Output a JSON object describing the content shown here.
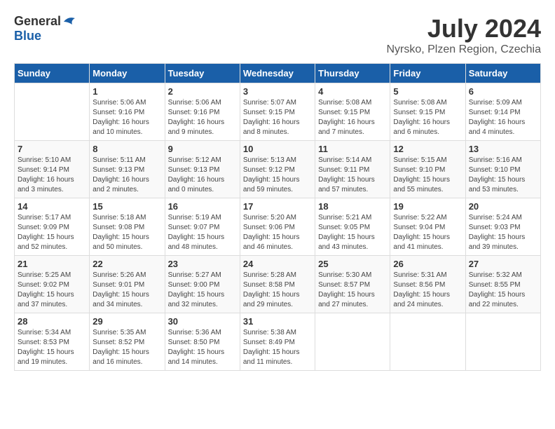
{
  "logo": {
    "general": "General",
    "blue": "Blue"
  },
  "title": "July 2024",
  "location": "Nyrsko, Plzen Region, Czechia",
  "weekdays": [
    "Sunday",
    "Monday",
    "Tuesday",
    "Wednesday",
    "Thursday",
    "Friday",
    "Saturday"
  ],
  "weeks": [
    [
      {
        "day": "",
        "sunrise": "",
        "sunset": "",
        "daylight": ""
      },
      {
        "day": "1",
        "sunrise": "Sunrise: 5:06 AM",
        "sunset": "Sunset: 9:16 PM",
        "daylight": "Daylight: 16 hours and 10 minutes."
      },
      {
        "day": "2",
        "sunrise": "Sunrise: 5:06 AM",
        "sunset": "Sunset: 9:16 PM",
        "daylight": "Daylight: 16 hours and 9 minutes."
      },
      {
        "day": "3",
        "sunrise": "Sunrise: 5:07 AM",
        "sunset": "Sunset: 9:15 PM",
        "daylight": "Daylight: 16 hours and 8 minutes."
      },
      {
        "day": "4",
        "sunrise": "Sunrise: 5:08 AM",
        "sunset": "Sunset: 9:15 PM",
        "daylight": "Daylight: 16 hours and 7 minutes."
      },
      {
        "day": "5",
        "sunrise": "Sunrise: 5:08 AM",
        "sunset": "Sunset: 9:15 PM",
        "daylight": "Daylight: 16 hours and 6 minutes."
      },
      {
        "day": "6",
        "sunrise": "Sunrise: 5:09 AM",
        "sunset": "Sunset: 9:14 PM",
        "daylight": "Daylight: 16 hours and 4 minutes."
      }
    ],
    [
      {
        "day": "7",
        "sunrise": "Sunrise: 5:10 AM",
        "sunset": "Sunset: 9:14 PM",
        "daylight": "Daylight: 16 hours and 3 minutes."
      },
      {
        "day": "8",
        "sunrise": "Sunrise: 5:11 AM",
        "sunset": "Sunset: 9:13 PM",
        "daylight": "Daylight: 16 hours and 2 minutes."
      },
      {
        "day": "9",
        "sunrise": "Sunrise: 5:12 AM",
        "sunset": "Sunset: 9:13 PM",
        "daylight": "Daylight: 16 hours and 0 minutes."
      },
      {
        "day": "10",
        "sunrise": "Sunrise: 5:13 AM",
        "sunset": "Sunset: 9:12 PM",
        "daylight": "Daylight: 15 hours and 59 minutes."
      },
      {
        "day": "11",
        "sunrise": "Sunrise: 5:14 AM",
        "sunset": "Sunset: 9:11 PM",
        "daylight": "Daylight: 15 hours and 57 minutes."
      },
      {
        "day": "12",
        "sunrise": "Sunrise: 5:15 AM",
        "sunset": "Sunset: 9:10 PM",
        "daylight": "Daylight: 15 hours and 55 minutes."
      },
      {
        "day": "13",
        "sunrise": "Sunrise: 5:16 AM",
        "sunset": "Sunset: 9:10 PM",
        "daylight": "Daylight: 15 hours and 53 minutes."
      }
    ],
    [
      {
        "day": "14",
        "sunrise": "Sunrise: 5:17 AM",
        "sunset": "Sunset: 9:09 PM",
        "daylight": "Daylight: 15 hours and 52 minutes."
      },
      {
        "day": "15",
        "sunrise": "Sunrise: 5:18 AM",
        "sunset": "Sunset: 9:08 PM",
        "daylight": "Daylight: 15 hours and 50 minutes."
      },
      {
        "day": "16",
        "sunrise": "Sunrise: 5:19 AM",
        "sunset": "Sunset: 9:07 PM",
        "daylight": "Daylight: 15 hours and 48 minutes."
      },
      {
        "day": "17",
        "sunrise": "Sunrise: 5:20 AM",
        "sunset": "Sunset: 9:06 PM",
        "daylight": "Daylight: 15 hours and 46 minutes."
      },
      {
        "day": "18",
        "sunrise": "Sunrise: 5:21 AM",
        "sunset": "Sunset: 9:05 PM",
        "daylight": "Daylight: 15 hours and 43 minutes."
      },
      {
        "day": "19",
        "sunrise": "Sunrise: 5:22 AM",
        "sunset": "Sunset: 9:04 PM",
        "daylight": "Daylight: 15 hours and 41 minutes."
      },
      {
        "day": "20",
        "sunrise": "Sunrise: 5:24 AM",
        "sunset": "Sunset: 9:03 PM",
        "daylight": "Daylight: 15 hours and 39 minutes."
      }
    ],
    [
      {
        "day": "21",
        "sunrise": "Sunrise: 5:25 AM",
        "sunset": "Sunset: 9:02 PM",
        "daylight": "Daylight: 15 hours and 37 minutes."
      },
      {
        "day": "22",
        "sunrise": "Sunrise: 5:26 AM",
        "sunset": "Sunset: 9:01 PM",
        "daylight": "Daylight: 15 hours and 34 minutes."
      },
      {
        "day": "23",
        "sunrise": "Sunrise: 5:27 AM",
        "sunset": "Sunset: 9:00 PM",
        "daylight": "Daylight: 15 hours and 32 minutes."
      },
      {
        "day": "24",
        "sunrise": "Sunrise: 5:28 AM",
        "sunset": "Sunset: 8:58 PM",
        "daylight": "Daylight: 15 hours and 29 minutes."
      },
      {
        "day": "25",
        "sunrise": "Sunrise: 5:30 AM",
        "sunset": "Sunset: 8:57 PM",
        "daylight": "Daylight: 15 hours and 27 minutes."
      },
      {
        "day": "26",
        "sunrise": "Sunrise: 5:31 AM",
        "sunset": "Sunset: 8:56 PM",
        "daylight": "Daylight: 15 hours and 24 minutes."
      },
      {
        "day": "27",
        "sunrise": "Sunrise: 5:32 AM",
        "sunset": "Sunset: 8:55 PM",
        "daylight": "Daylight: 15 hours and 22 minutes."
      }
    ],
    [
      {
        "day": "28",
        "sunrise": "Sunrise: 5:34 AM",
        "sunset": "Sunset: 8:53 PM",
        "daylight": "Daylight: 15 hours and 19 minutes."
      },
      {
        "day": "29",
        "sunrise": "Sunrise: 5:35 AM",
        "sunset": "Sunset: 8:52 PM",
        "daylight": "Daylight: 15 hours and 16 minutes."
      },
      {
        "day": "30",
        "sunrise": "Sunrise: 5:36 AM",
        "sunset": "Sunset: 8:50 PM",
        "daylight": "Daylight: 15 hours and 14 minutes."
      },
      {
        "day": "31",
        "sunrise": "Sunrise: 5:38 AM",
        "sunset": "Sunset: 8:49 PM",
        "daylight": "Daylight: 15 hours and 11 minutes."
      },
      {
        "day": "",
        "sunrise": "",
        "sunset": "",
        "daylight": ""
      },
      {
        "day": "",
        "sunrise": "",
        "sunset": "",
        "daylight": ""
      },
      {
        "day": "",
        "sunrise": "",
        "sunset": "",
        "daylight": ""
      }
    ]
  ]
}
